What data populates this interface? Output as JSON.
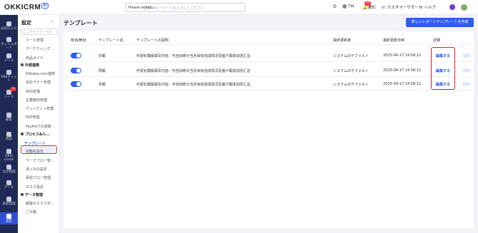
{
  "brand": {
    "name": "OKKICRM",
    "ai": "AI"
  },
  "search": {
    "scope": "Please selekt",
    "placeholder": "検索キーワードを入力してください"
  },
  "topnav": {
    "user": "TM",
    "notify": "通知",
    "notify_count": "32",
    "support": "カスタマーサポート",
    "help": "ヘルプ"
  },
  "leftnav": [
    {
      "label": "お気に入り",
      "icon": "star-icon"
    },
    {
      "label": "ダッシュボード",
      "icon": "dashboard-icon"
    },
    {
      "label": "メール",
      "icon": "mail-icon"
    },
    {
      "label": "SNSチャット",
      "icon": "chat-icon"
    },
    {
      "label": "リード",
      "icon": "lead-icon",
      "badge": "74"
    },
    {
      "label": "顧客",
      "icon": "customer-icon"
    },
    {
      "label": "商談",
      "icon": "deal-icon"
    },
    {
      "label": "OKKI Leads",
      "icon": "leads-icon"
    },
    {
      "label": "注文管理",
      "icon": "order-icon"
    },
    {
      "label": "データ",
      "icon": "data-icon"
    },
    {
      "label": "承認管理",
      "icon": "approval-icon"
    },
    {
      "label": "設定",
      "icon": "settings-icon"
    }
  ],
  "sidebar": {
    "title": "設定",
    "search_placeholder": "ここでキーワードを",
    "items_top": [
      "メール管理",
      "マーケティング...",
      "商品ガイド"
    ],
    "group_external": "外部連携",
    "items_external": [
      "Alibaba.com連携",
      "自社サイト管理",
      "SNS管理",
      "企業微信管理",
      "ディンディン管理",
      "ERP管理",
      "PayPalでの受取"
    ],
    "group_process": "プロセス&ル...",
    "items_process": [
      "テンプレート",
      "自動化設定",
      "ワークフロー管...",
      "流入元の設定",
      "承認フロー管理",
      "タスク設定"
    ],
    "group_data": "データ管理",
    "items_data": [
      "顧客のエクスポ...",
      "ごみ箱"
    ]
  },
  "page": {
    "title": "テンプレート",
    "new_button": "新しいレポートテンプレートを作成"
  },
  "table": {
    "headers": [
      "有効/無効",
      "テンプレート名",
      "テンプレートの説明",
      "最終更新者",
      "最終更新日時",
      "詳細"
    ],
    "rows": [
      {
        "name": "日報",
        "desc": "可视化模版填写内容、可自动统计当月目标完成情况及客户跟进动态汇总",
        "updater": "システムのデフォルト",
        "updated": "2025-04-17 14:58:12",
        "edit": "編集する",
        "delete": "削除",
        "enabled": true
      },
      {
        "name": "周報",
        "desc": "可视化模版填写内容、可自动统计当月目标完成情况及客户跟进动态汇总",
        "updater": "システムのデフォルト",
        "updated": "2025-04-17 14:58:12",
        "edit": "編集する",
        "delete": "削除",
        "enabled": true
      },
      {
        "name": "月報",
        "desc": "可视化模版填写内容、可自动统计当月目标完成情况及客户跟进动态汇总",
        "updater": "システムのデフォルト",
        "updated": "2025-04-17 14:58:12",
        "edit": "編集する",
        "delete": "削除",
        "enabled": true
      }
    ]
  },
  "colors": {
    "accent": "#2f5cf1",
    "nav": "#1f2a56",
    "highlight": "#e02020"
  }
}
